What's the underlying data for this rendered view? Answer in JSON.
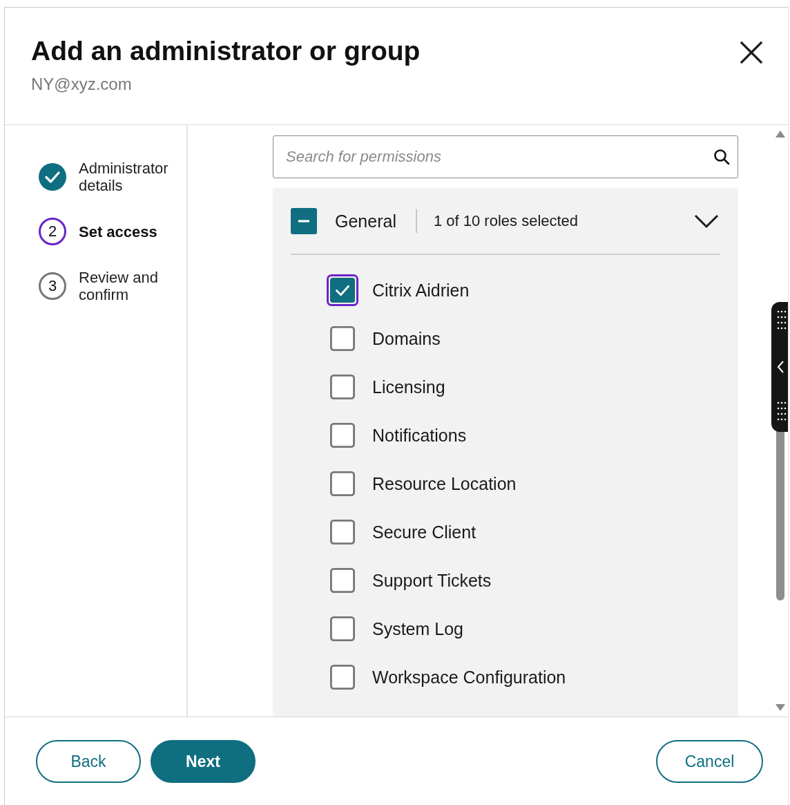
{
  "dialog": {
    "title": "Add an administrator or group",
    "subtitle": "NY@xyz.com"
  },
  "steps": [
    {
      "label": "Administrator details",
      "completed": true,
      "current": false
    },
    {
      "number": "2",
      "label": "Set access",
      "completed": false,
      "current": true
    },
    {
      "number": "3",
      "label": "Review and confirm",
      "completed": false,
      "current": false
    }
  ],
  "search": {
    "placeholder": "Search for permissions"
  },
  "group": {
    "name": "General",
    "summary": "1 of 10 roles selected",
    "expanded": true,
    "partial": true
  },
  "roles": [
    {
      "label": "Citrix Aidrien",
      "checked": true,
      "focused": true
    },
    {
      "label": "Domains",
      "checked": false,
      "focused": false
    },
    {
      "label": "Licensing",
      "checked": false,
      "focused": false
    },
    {
      "label": "Notifications",
      "checked": false,
      "focused": false
    },
    {
      "label": "Resource Location",
      "checked": false,
      "focused": false
    },
    {
      "label": "Secure Client",
      "checked": false,
      "focused": false
    },
    {
      "label": "Support Tickets",
      "checked": false,
      "focused": false
    },
    {
      "label": "System Log",
      "checked": false,
      "focused": false
    },
    {
      "label": "Workspace Configuration",
      "checked": false,
      "focused": false
    }
  ],
  "footer": {
    "left_buttons": [
      {
        "label": "Back",
        "kind": "outline"
      },
      {
        "label": "Next",
        "kind": "primary"
      }
    ],
    "right_buttons": [
      {
        "label": "Cancel",
        "kind": "outline"
      }
    ]
  }
}
